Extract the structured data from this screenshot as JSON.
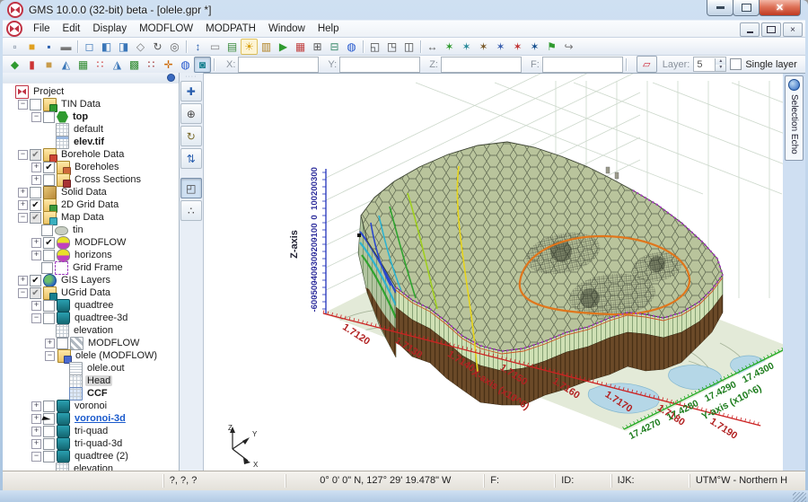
{
  "window": {
    "title": "GMS 10.0.0 (32-bit) beta - [olele.gpr *]"
  },
  "menu": {
    "items": [
      "File",
      "Edit",
      "Display",
      "MODFLOW",
      "MODPATH",
      "Window",
      "Help"
    ]
  },
  "toolbar_main": {
    "icons": [
      "new",
      "open",
      "save",
      "print",
      "sep",
      "plan-view",
      "front-view",
      "side-view",
      "oblique-view",
      "rotate-view",
      "previous-view",
      "sep",
      "measure",
      "properties",
      "annotation",
      "display-options",
      "contour-options",
      "play-animation",
      "color-ramp",
      "calculator",
      "add-plot",
      "web-overlay",
      "sep",
      "bring-forward",
      "send-backward",
      "frame-image",
      "sep",
      "dimension",
      "map-to-tin",
      "map-to-borehole",
      "map-to-solid",
      "map-to-mesh",
      "map-to-grid",
      "map-to-ugrid",
      "export-flag",
      "redirect"
    ]
  },
  "toolbar_edit": {
    "modules": [
      "tin-module",
      "borehole-module",
      "solid-module",
      "mesh2d-module",
      "grid2d-module",
      "scatter2d-module",
      "mesh3d-module",
      "grid3d-module",
      "scatter3d-module",
      "map-module",
      "gis-module",
      "ugrid-module"
    ],
    "active_module": "ugrid-module",
    "fields": [
      {
        "label": "X:",
        "value": ""
      },
      {
        "label": "Y:",
        "value": ""
      },
      {
        "label": "Z:",
        "value": ""
      },
      {
        "label": "F:",
        "value": ""
      }
    ],
    "layer": {
      "label": "Layer:",
      "value": "5",
      "checkbox_label": "Single layer",
      "checkbox_checked": false
    }
  },
  "explorer": {
    "items": [
      {
        "indent": 0,
        "expand": null,
        "check": null,
        "icon": "i-project",
        "label": "Project"
      },
      {
        "indent": 1,
        "expand": "minus",
        "check": "unchecked",
        "icon": "i-folder-tin",
        "label": "TIN Data"
      },
      {
        "indent": 2,
        "expand": "minus",
        "check": "unchecked",
        "icon": "i-tin",
        "label": "top",
        "bold": true
      },
      {
        "indent": 3,
        "expand": null,
        "check": null,
        "icon": "i-dataset",
        "label": "default"
      },
      {
        "indent": 3,
        "expand": null,
        "check": null,
        "icon": "i-dataset-b",
        "label": "elev.tif",
        "bold": true
      },
      {
        "indent": 1,
        "expand": "minus",
        "check": "mixed",
        "icon": "i-folder-bh",
        "label": "Borehole Data"
      },
      {
        "indent": 2,
        "expand": "plus",
        "check": "checked",
        "icon": "i-folder-bh2",
        "label": "Boreholes"
      },
      {
        "indent": 2,
        "expand": "plus",
        "check": "unchecked",
        "icon": "i-folder-cross",
        "label": "Cross Sections"
      },
      {
        "indent": 1,
        "expand": "plus",
        "check": "unchecked",
        "icon": "i-solid",
        "label": "Solid Data"
      },
      {
        "indent": 1,
        "expand": "plus",
        "check": "checked",
        "icon": "i-folder-grid",
        "label": "2D Grid Data"
      },
      {
        "indent": 1,
        "expand": "minus",
        "check": "mixed",
        "icon": "i-folder-map",
        "label": "Map Data"
      },
      {
        "indent": 2,
        "expand": null,
        "check": "unchecked",
        "icon": "i-coverage",
        "label": "tin"
      },
      {
        "indent": 2,
        "expand": "plus",
        "check": "checked",
        "icon": "i-layers",
        "label": "MODFLOW"
      },
      {
        "indent": 2,
        "expand": "plus",
        "check": "unchecked",
        "icon": "i-layers",
        "label": "horizons"
      },
      {
        "indent": 2,
        "expand": null,
        "check": "unchecked",
        "icon": "i-gridframe",
        "label": "Grid Frame"
      },
      {
        "indent": 1,
        "expand": "plus",
        "check": "checked",
        "icon": "i-gis",
        "label": "GIS Layers"
      },
      {
        "indent": 1,
        "expand": "minus",
        "check": "mixed",
        "icon": "i-folder-ugrid",
        "label": "UGrid Data"
      },
      {
        "indent": 2,
        "expand": "plus",
        "check": "unchecked",
        "icon": "i-ugrid",
        "label": "quadtree"
      },
      {
        "indent": 2,
        "expand": "minus",
        "check": "unchecked",
        "icon": "i-ugrid",
        "label": "quadtree-3d"
      },
      {
        "indent": 3,
        "expand": null,
        "check": null,
        "icon": "i-dataset",
        "label": "elevation"
      },
      {
        "indent": 3,
        "expand": "plus",
        "check": "unchecked",
        "icon": "i-checker",
        "label": "MODFLOW"
      },
      {
        "indent": 3,
        "expand": "minus",
        "check": null,
        "icon": "i-folder-lock",
        "label": "olele (MODFLOW)"
      },
      {
        "indent": 4,
        "expand": null,
        "check": null,
        "icon": "i-doc",
        "label": "olele.out"
      },
      {
        "indent": 4,
        "expand": null,
        "check": null,
        "icon": "i-dataset",
        "label": "Head",
        "highlighted": true
      },
      {
        "indent": 4,
        "expand": null,
        "check": null,
        "icon": "i-dataset-blue",
        "label": "CCF",
        "bold": true
      },
      {
        "indent": 2,
        "expand": "plus",
        "check": "unchecked",
        "icon": "i-ugrid",
        "label": "voronoi"
      },
      {
        "indent": 2,
        "expand": "plus",
        "check": "unchecked",
        "icon": "i-ugrid",
        "label": "voronoi-3d",
        "selected": true,
        "cursor": true
      },
      {
        "indent": 2,
        "expand": "plus",
        "check": "unchecked",
        "icon": "i-ugrid",
        "label": "tri-quad"
      },
      {
        "indent": 2,
        "expand": "plus",
        "check": "unchecked",
        "icon": "i-ugrid",
        "label": "tri-quad-3d"
      },
      {
        "indent": 2,
        "expand": "minus",
        "check": "unchecked",
        "icon": "i-ugrid",
        "label": "quadtree (2)"
      },
      {
        "indent": 3,
        "expand": null,
        "check": null,
        "icon": "i-dataset",
        "label": "elevation"
      }
    ]
  },
  "tools": {
    "items": [
      {
        "name": "pan-tool"
      },
      {
        "name": "zoom-tool"
      },
      {
        "name": "rotate-tool"
      },
      {
        "name": "vertical-exaggeration-tool"
      },
      {
        "name": "select-ugrid-cell-tool",
        "active": true
      },
      {
        "name": "select-vertex-tool"
      }
    ]
  },
  "selection_echo": {
    "label": "Selection Echo"
  },
  "scene": {
    "axes": {
      "x": {
        "label": "X-axis (x10^6)",
        "ticks": [
          "1.7120",
          "1.7130",
          "1.7140",
          "1.7150",
          "1.7160",
          "1.7170",
          "1.7180",
          "1.7190"
        ],
        "color": "#b22222"
      },
      "y": {
        "label": "Y-axis (x10^6)",
        "ticks": [
          "17.4270",
          "17.4280",
          "17.4290",
          "17.4300"
        ],
        "color": "#1e7d1e"
      },
      "z": {
        "label": "Z-axis",
        "ticks": [
          "300",
          "200",
          "100",
          "0",
          "-100",
          "-200",
          "-300",
          "-400",
          "-500",
          "-600"
        ],
        "color": "#2a2a9a"
      }
    },
    "triad": {
      "labels": [
        "Z",
        "Y",
        "X"
      ]
    }
  },
  "status": {
    "cells": [
      "?, ?, ?",
      "0° 0' 0\" N, 127° 29' 19.478\" W",
      "F:",
      "ID:",
      "IJK:",
      "UTM°W - Northern H"
    ]
  }
}
